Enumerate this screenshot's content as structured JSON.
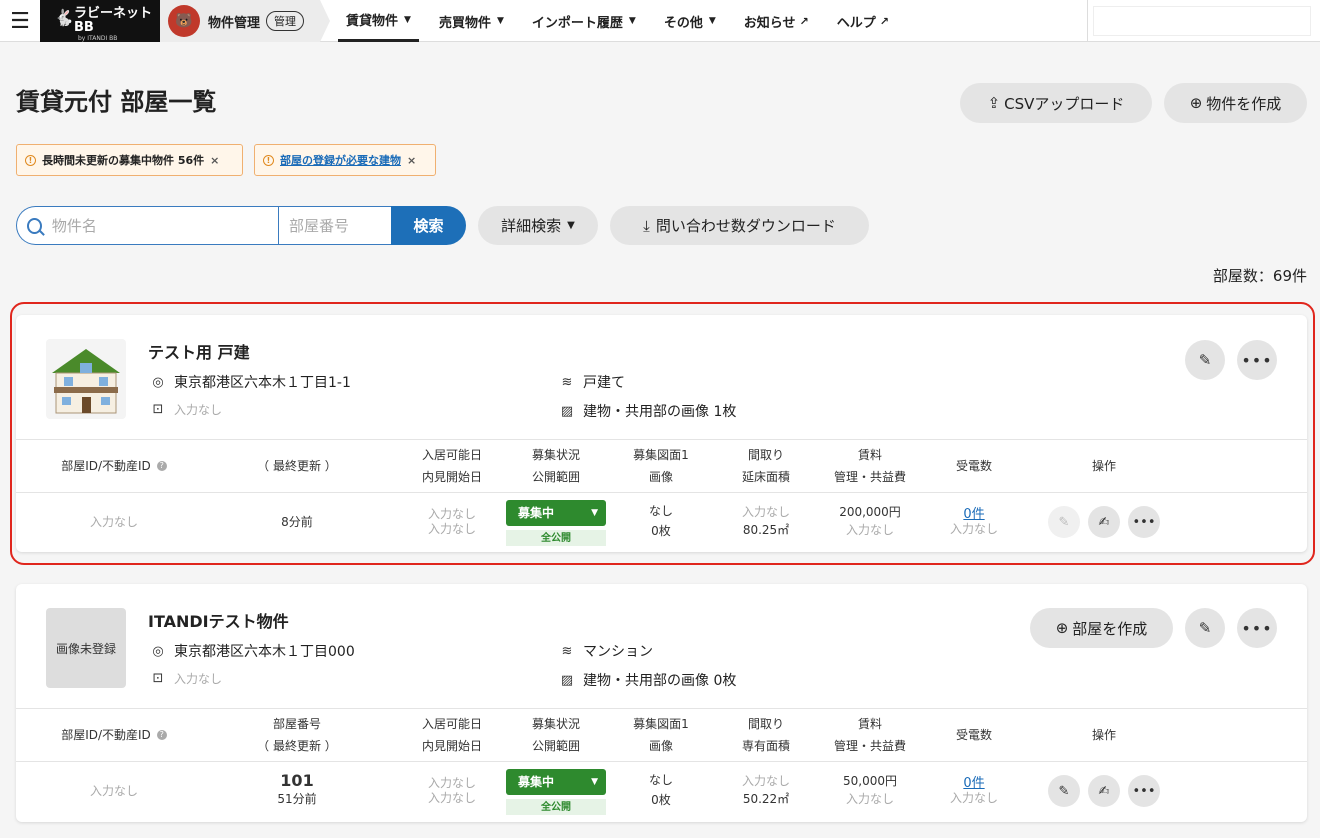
{
  "header": {
    "logo_main": "ラビーネットBB",
    "logo_sub": "by ITANDI BB",
    "product": "物件管理",
    "product_badge": "管理",
    "nav": [
      {
        "label": "賃貸物件",
        "active": true,
        "chevron": true
      },
      {
        "label": "売買物件",
        "chevron": true
      },
      {
        "label": "インポート履歴",
        "chevron": true
      },
      {
        "label": "その他",
        "chevron": true
      },
      {
        "label": "お知らせ",
        "external": true
      },
      {
        "label": "ヘルプ",
        "external": true
      }
    ]
  },
  "page": {
    "title": "賃貸元付 部屋一覧",
    "csv_upload": "CSVアップロード",
    "create_property": "物件を作成"
  },
  "alerts": [
    {
      "text": "長時間未更新の募集中物件 56件"
    },
    {
      "text": "部屋の登録が必要な建物"
    }
  ],
  "search": {
    "name_placeholder": "物件名",
    "room_placeholder": "部屋番号",
    "button": "検索",
    "detail": "詳細検索",
    "download": "問い合わせ数ダウンロード"
  },
  "room_count": "部屋数：69件",
  "columns_common": {
    "id": "部屋ID/不動産ID",
    "avail1": "入居可能日",
    "avail2": "内見開始日",
    "status1": "募集状況",
    "status2": "公開範囲",
    "plan1": "募集図面1",
    "plan2": "画像",
    "layout": "間取り",
    "rent1": "賃料",
    "rent2": "管理・共益費",
    "calls": "受電数",
    "ops": "操作"
  },
  "properties": [
    {
      "name": "テスト用 戸建",
      "address": "東京都港区六本木１丁目1-1",
      "station": "入力なし",
      "type": "戸建て",
      "images": "建物・共用部の画像 1枚",
      "col_room2": "（ 最終更新 ）",
      "col_area": "延床面積",
      "room": {
        "id": "入力なし",
        "updated": "8分前",
        "avail1": "入力なし",
        "avail2": "入力なし",
        "status": "募集中",
        "publish": "全公開",
        "plan": "なし",
        "images": "0枚",
        "layout": "入力なし",
        "area": "80.25㎡",
        "rent": "200,000円",
        "fee": "入力なし",
        "calls": "0件",
        "calls_sub": "入力なし"
      }
    },
    {
      "name": "ITANDIテスト物件",
      "thumb_text": "画像未登録",
      "address": "東京都港区六本木１丁目000",
      "station": "入力なし",
      "type": "マンション",
      "images": "建物・共用部の画像 0枚",
      "add_room": "部屋を作成",
      "col_room1": "部屋番号",
      "col_room2": "（ 最終更新 ）",
      "col_area": "専有面積",
      "room": {
        "id": "入力なし",
        "number": "101",
        "updated": "51分前",
        "avail1": "入力なし",
        "avail2": "入力なし",
        "status": "募集中",
        "publish": "全公開",
        "plan": "なし",
        "images": "0枚",
        "layout": "入力なし",
        "area": "50.22㎡",
        "rent": "50,000円",
        "fee": "入力なし",
        "calls": "0件",
        "calls_sub": "入力なし"
      }
    }
  ]
}
